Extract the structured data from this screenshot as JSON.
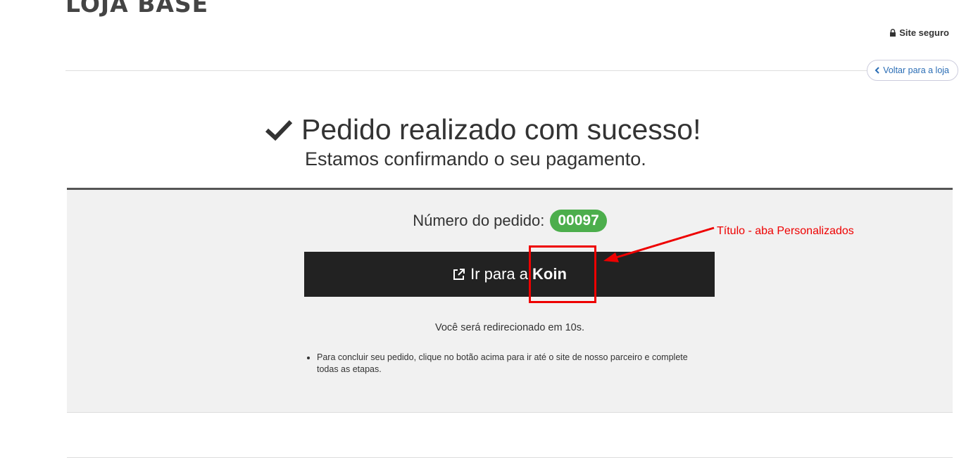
{
  "header": {
    "store_name": "LOJA BASE",
    "secure_label": "Site seguro",
    "secure_icon": "lock-icon",
    "back_label": "Voltar para a loja",
    "back_icon": "chevron-left-icon"
  },
  "confirmation": {
    "title": "Pedido realizado com sucesso!",
    "subtitle": "Estamos confirmando o seu pagamento.",
    "title_icon": "checkmark-icon"
  },
  "order": {
    "label": "Número do pedido:",
    "number": "00097",
    "badge_color": "#4cae4c"
  },
  "payment": {
    "button_prefix": "Ir para a",
    "button_provider": "Koin",
    "button_icon": "external-link-icon",
    "redirect_text": "Você será redirecionado em 10s.",
    "instructions": [
      "Para concluir seu pedido, clique no botão acima para ir até o site de nosso parceiro e complete todas as etapas."
    ]
  },
  "annotation": {
    "label": "Título - aba Personalizados",
    "color": "#e00000"
  }
}
